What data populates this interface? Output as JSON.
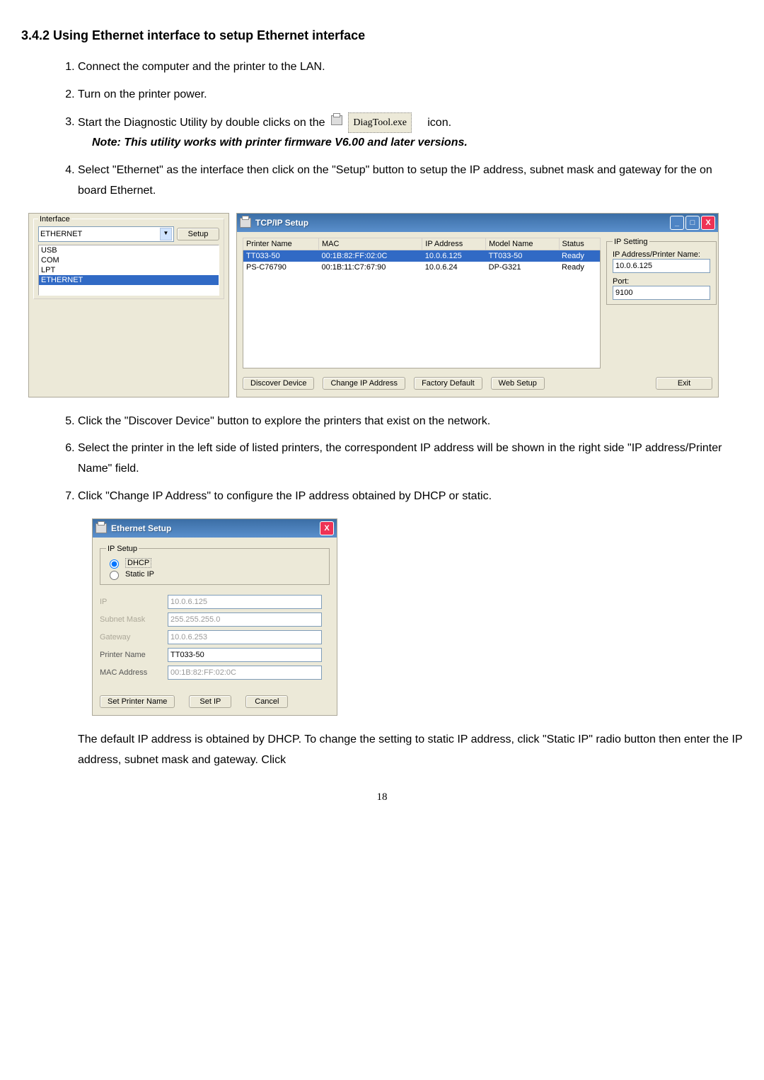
{
  "heading": "3.4.2 Using Ethernet interface to setup Ethernet interface",
  "step1": "Connect the computer and the printer to the LAN.",
  "step2": "Turn on the printer power.",
  "step3_a": "Start the Diagnostic Utility by double clicks on the",
  "diag_label": "DiagTool.exe",
  "step3_b": "icon.",
  "note": "Note: This utility works with printer firmware V6.00 and later versions.",
  "step4": "Select \"Ethernet\" as the interface then click on the \"Setup\" button to setup the IP address, subnet mask and gateway for the on board Ethernet.",
  "interface": {
    "legend": "Interface",
    "selected": "ETHERNET",
    "setup_btn": "Setup",
    "items": [
      "USB",
      "COM",
      "LPT",
      "ETHERNET"
    ]
  },
  "tcpip": {
    "title": "TCP/IP Setup",
    "cols": [
      "Printer Name",
      "MAC",
      "IP Address",
      "Model Name",
      "Status"
    ],
    "rows": [
      {
        "name": "TT033-50",
        "mac": "00:1B:82:FF:02:0C",
        "ip": "10.0.6.125",
        "model": "TT033-50",
        "status": "Ready",
        "sel": true
      },
      {
        "name": "PS-C76790",
        "mac": "00:1B:11:C7:67:90",
        "ip": "10.0.6.24",
        "model": "DP-G321",
        "status": "Ready",
        "sel": false
      }
    ],
    "ip_setting_legend": "IP Setting",
    "ip_label": "IP Address/Printer Name:",
    "ip_value": "10.0.6.125",
    "port_label": "Port:",
    "port_value": "9100",
    "btn_discover": "Discover Device",
    "btn_change": "Change IP Address",
    "btn_factory": "Factory Default",
    "btn_web": "Web Setup",
    "btn_exit": "Exit"
  },
  "step5": "Click the \"Discover Device\" button to explore the printers that exist on the network.",
  "step6": "Select the printer in the left side of listed printers, the correspondent IP address will be shown in the right side \"IP address/Printer Name\" field.",
  "step7": "Click \"Change IP Address\" to configure the IP address obtained by DHCP or static.",
  "eth": {
    "title": "Ethernet Setup",
    "legend": "IP Setup",
    "opt_dhcp": "DHCP",
    "opt_static": "Static IP",
    "lbl_ip": "IP",
    "val_ip": "10.0.6.125",
    "lbl_mask": "Subnet Mask",
    "val_mask": "255.255.255.0",
    "lbl_gw": "Gateway",
    "val_gw": "10.0.6.253",
    "lbl_pname": "Printer Name",
    "val_pname": "TT033-50",
    "lbl_mac": "MAC Address",
    "val_mac": "00:1B:82:FF:02:0C",
    "btn_setname": "Set Printer Name",
    "btn_setip": "Set IP",
    "btn_cancel": "Cancel"
  },
  "para": "The default IP address is obtained by DHCP. To change the setting to static IP address, click \"Static IP\" radio button then enter the IP address, subnet mask and gateway. Click",
  "page": "18"
}
